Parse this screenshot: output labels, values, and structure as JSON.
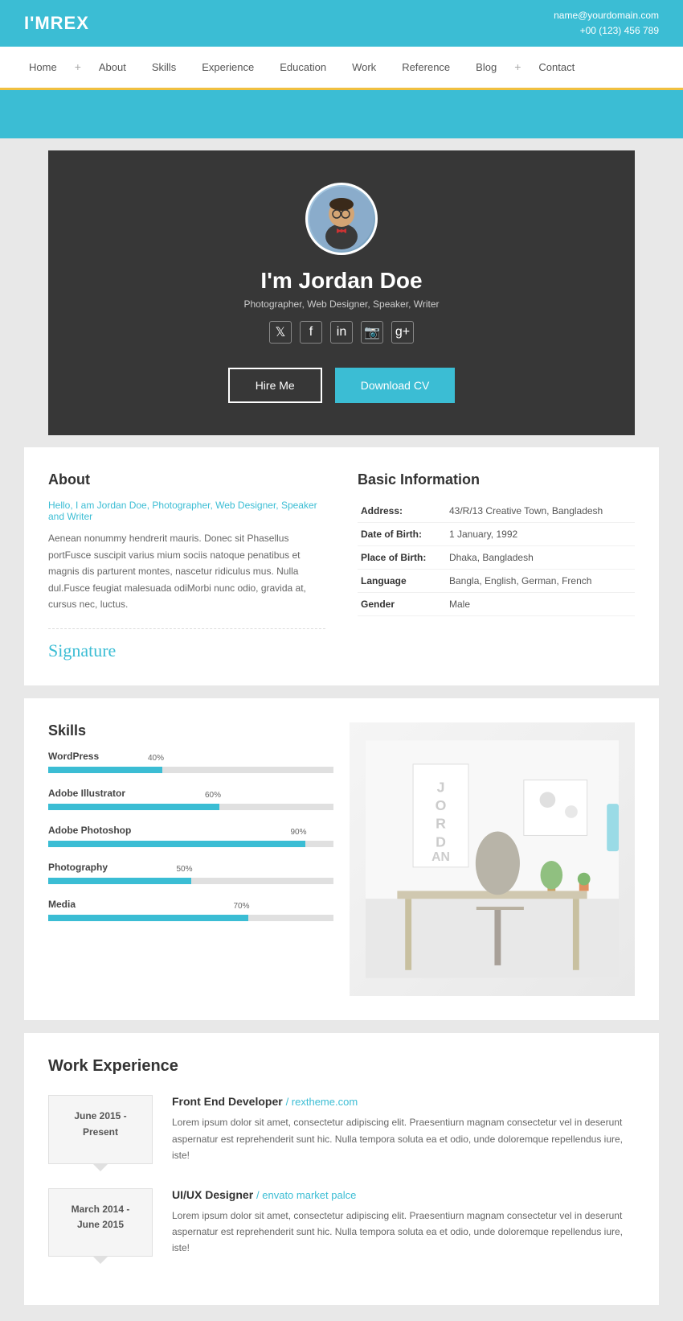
{
  "header": {
    "logo": "I'MREX",
    "email": "name@yourdomain.com",
    "phone": "+00 (123) 456 789"
  },
  "nav": {
    "items": [
      {
        "label": "Home",
        "plus": true
      },
      {
        "label": "About"
      },
      {
        "label": "Skills"
      },
      {
        "label": "Experience"
      },
      {
        "label": "Education"
      },
      {
        "label": "Work"
      },
      {
        "label": "Reference"
      },
      {
        "label": "Blog",
        "plus": true
      },
      {
        "label": "Contact"
      }
    ]
  },
  "hero": {
    "name": "I'm Jordan Doe",
    "subtitle": "Photographer, Web Designer, Speaker, Writer",
    "btn_hire": "Hire Me",
    "btn_download": "Download CV",
    "social": [
      "𝕏",
      "f",
      "in",
      "📷",
      "g+"
    ]
  },
  "about": {
    "title": "About",
    "intro": "Hello, I am Jordan Doe, Photographer, Web Designer, Speaker and Writer",
    "body": "Aenean nonummy hendrerit mauris. Donec sit Phasellus portFusce suscipit varius mium sociis natoque penatibus et magnis dis parturent montes, nascetur ridiculus mus. Nulla dul.Fusce feugiat malesuada odiMorbi nunc odio, gravida at, cursus nec, luctus.",
    "signature": "Signature"
  },
  "basic_info": {
    "title": "Basic Information",
    "rows": [
      {
        "label": "Address:",
        "value": "43/R/13 Creative Town, Bangladesh"
      },
      {
        "label": "Date of Birth:",
        "value": "1 January, 1992"
      },
      {
        "label": "Place of Birth:",
        "value": "Dhaka, Bangladesh"
      },
      {
        "label": "Language",
        "value": "Bangla, English, German, French"
      },
      {
        "label": "Gender",
        "value": "Male"
      }
    ]
  },
  "skills": {
    "title": "Skills",
    "items": [
      {
        "label": "WordPress",
        "pct": 40
      },
      {
        "label": "Adobe Illustrator",
        "pct": 60
      },
      {
        "label": "Adobe Photoshop",
        "pct": 90
      },
      {
        "label": "Photography",
        "pct": 50
      },
      {
        "label": "Media",
        "pct": 70
      }
    ]
  },
  "work_experience": {
    "title": "Work Experience",
    "items": [
      {
        "date": "June 2015 - Present",
        "job_title": "Front End Developer",
        "company": "/ rextheme.com",
        "desc": "Lorem ipsum dolor sit amet, consectetur adipiscing elit. Praesentium magnam consectetur vel in deserunt aspernatur est reprehenderit sunt hic. Nulla tempora soluta ea et odio, unde doloremque repellendus iure, iste!"
      },
      {
        "date": "March 2014 - June 2015",
        "job_title": "UI/UX Designer",
        "company": "/ envato market palce",
        "desc": "Lorem ipsum dolor sit amet, consectetur adipiscing elit. Praesentiurn magnam consectetur vel in deserunt aspernatur est reprehenderit sunt hic. Nulla tempora soluta ea et odio, unde doloremque repellendus iure, iste!"
      }
    ]
  },
  "colors": {
    "accent": "#3bbdd4",
    "bg": "#e8e8e8",
    "gold": "#f0c040"
  }
}
